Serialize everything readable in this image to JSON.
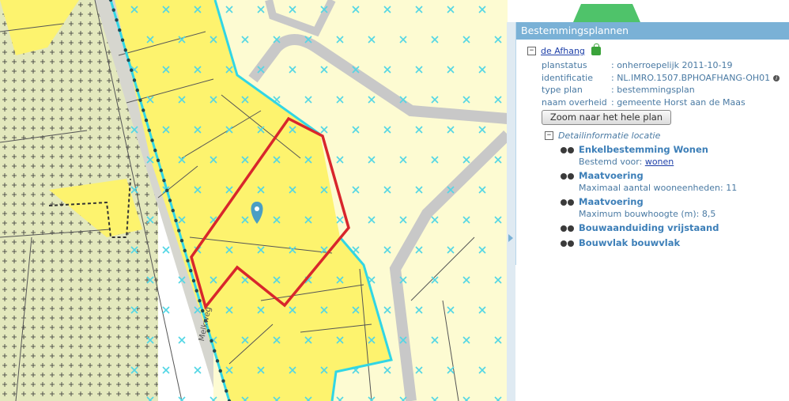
{
  "map": {
    "street_label": "Melkweg",
    "colors": {
      "yellow_zone": "#fdf36e",
      "pale_zone": "#fdfbd2",
      "green_zone": "#e3e8bd",
      "road": "#c8c8c8",
      "cross_marker": "#52d6e5",
      "plan_boundary": "#31d6e5",
      "selection": "#d8262c",
      "pin": "#4a9ec4",
      "green_top": "#4fc36a"
    }
  },
  "panel": {
    "title": "Bestemmingsplannen",
    "plan": {
      "name": "de Afhang",
      "properties": [
        {
          "key": "planstatus",
          "value": ": onherroepelijk 2011-10-19"
        },
        {
          "key": "identificatie",
          "value": ": NL.IMRO.1507.BPHOAFHANG-OH01"
        },
        {
          "key": "type plan",
          "value": ": bestemmingsplan"
        },
        {
          "key": "naam overheid",
          "value": ": gemeente Horst aan de Maas"
        }
      ],
      "zoom_button": "Zoom naar het hele plan"
    },
    "detail": {
      "header": "Detailinformatie locatie",
      "items": [
        {
          "title": "Enkelbestemming Wonen",
          "sub_prefix": "Bestemd voor: ",
          "sub_link": "wonen"
        },
        {
          "title": "Maatvoering",
          "sub": "Maximaal aantal wooneenheden: 11"
        },
        {
          "title": "Maatvoering",
          "sub": "Maximum bouwhoogte (m): 8,5"
        },
        {
          "title": "Bouwaanduiding vrijstaand"
        },
        {
          "title": "Bouwvlak bouwvlak"
        }
      ]
    }
  }
}
